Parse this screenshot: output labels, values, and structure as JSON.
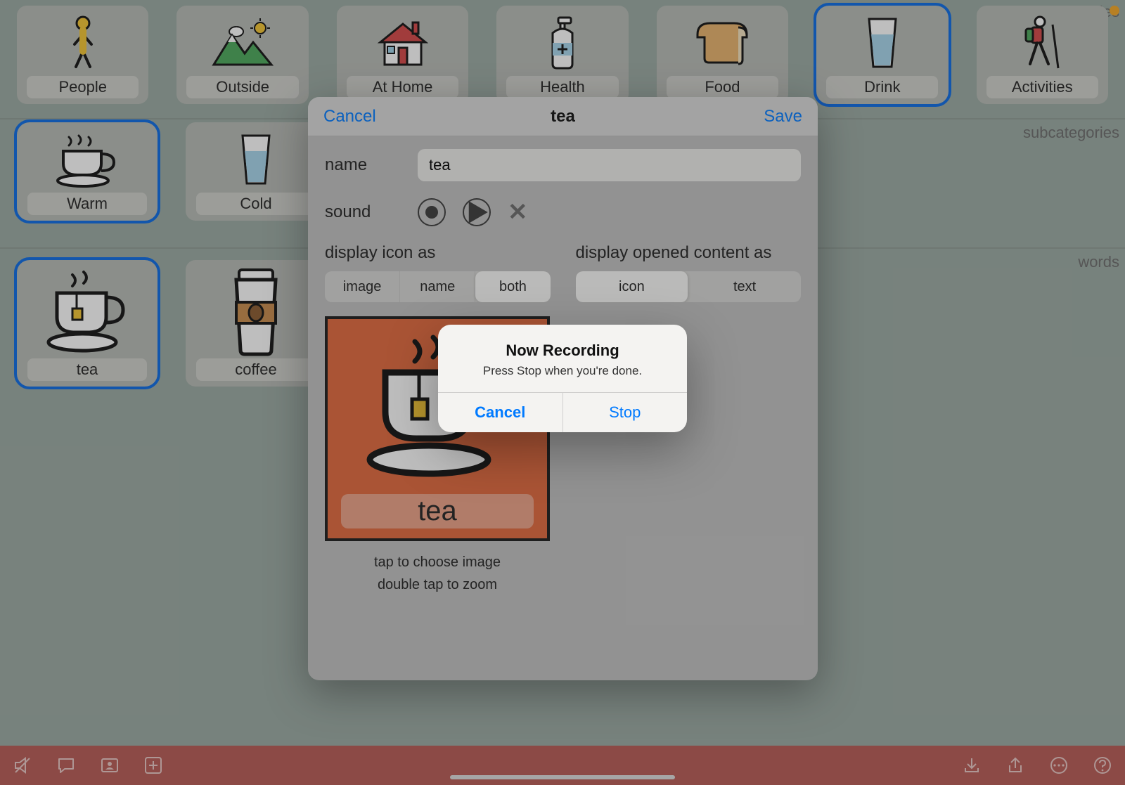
{
  "section_labels": {
    "categories": "categories",
    "subcategories": "subcategories",
    "words": "words"
  },
  "categories": [
    {
      "id": "people",
      "label": "People"
    },
    {
      "id": "outside",
      "label": "Outside"
    },
    {
      "id": "at-home",
      "label": "At Home"
    },
    {
      "id": "health",
      "label": "Health"
    },
    {
      "id": "food",
      "label": "Food"
    },
    {
      "id": "drink",
      "label": "Drink",
      "selected": true
    },
    {
      "id": "activities",
      "label": "Activities"
    }
  ],
  "subcategories": [
    {
      "id": "warm",
      "label": "Warm",
      "selected": true
    },
    {
      "id": "cold",
      "label": "Cold"
    }
  ],
  "words": [
    {
      "id": "tea",
      "label": "tea",
      "selected": true
    },
    {
      "id": "coffee",
      "label": "coffee"
    }
  ],
  "editor": {
    "cancel": "Cancel",
    "save": "Save",
    "title": "tea",
    "name_label": "name",
    "name_value": "tea",
    "sound_label": "sound",
    "display_icon_label": "display icon as",
    "display_content_label": "display opened content as",
    "seg_icon": {
      "options": [
        "image",
        "name",
        "both"
      ],
      "active": "both"
    },
    "seg_content": {
      "options": [
        "icon",
        "text"
      ],
      "active": "icon"
    },
    "preview_label": "tea",
    "hint1": "tap to choose image",
    "hint2": "double tap to zoom"
  },
  "alert": {
    "title": "Now Recording",
    "message": "Press Stop when you're done.",
    "cancel": "Cancel",
    "stop": "Stop"
  },
  "colors": {
    "accent": "#007aff",
    "toolbar": "#b85a54",
    "selection": "#0a6ae6",
    "preview_bg": "#e2683c"
  }
}
